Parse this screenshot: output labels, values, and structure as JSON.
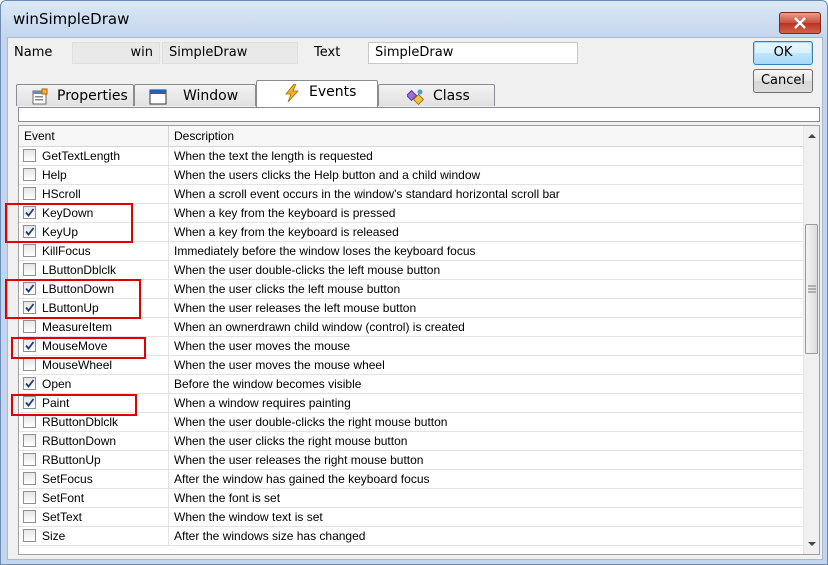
{
  "window": {
    "title": "winSimpleDraw"
  },
  "header": {
    "name_label": "Name",
    "name_prefix": "win",
    "name_value": "SimpleDraw",
    "text_label": "Text",
    "text_value": "SimpleDraw"
  },
  "buttons": {
    "ok": "OK",
    "cancel": "Cancel"
  },
  "tabs": [
    {
      "label": "Properties",
      "icon": "properties-icon"
    },
    {
      "label": "Window",
      "icon": "window-icon"
    },
    {
      "label": "Events",
      "icon": "lightning-icon",
      "active": true
    },
    {
      "label": "Class",
      "icon": "class-icon"
    }
  ],
  "grid": {
    "columns": [
      "Event",
      "Description"
    ],
    "rows": [
      {
        "event": "GetTextLength",
        "checked": false,
        "description": "When the text the length is requested"
      },
      {
        "event": "Help",
        "checked": false,
        "description": "When the users clicks the Help button and a child window"
      },
      {
        "event": "HScroll",
        "checked": false,
        "description": "When a scroll event occurs in the window's standard horizontal scroll bar"
      },
      {
        "event": "KeyDown",
        "checked": true,
        "description": "When a key from the keyboard is pressed"
      },
      {
        "event": "KeyUp",
        "checked": true,
        "description": "When a key from the keyboard is released"
      },
      {
        "event": "KillFocus",
        "checked": false,
        "description": "Immediately before the window loses the keyboard focus"
      },
      {
        "event": "LButtonDblclk",
        "checked": false,
        "description": "When the user double-clicks the left mouse button"
      },
      {
        "event": "LButtonDown",
        "checked": true,
        "description": "When the user clicks the left mouse button"
      },
      {
        "event": "LButtonUp",
        "checked": true,
        "description": "When the user releases the left mouse button"
      },
      {
        "event": "MeasureItem",
        "checked": false,
        "description": "When an ownerdrawn child window (control) is created"
      },
      {
        "event": "MouseMove",
        "checked": true,
        "description": "When the user moves the mouse"
      },
      {
        "event": "MouseWheel",
        "checked": false,
        "description": "When the user moves the mouse wheel"
      },
      {
        "event": "Open",
        "checked": true,
        "description": "Before the window becomes visible"
      },
      {
        "event": "Paint",
        "checked": true,
        "description": "When a window requires painting"
      },
      {
        "event": "RButtonDblclk",
        "checked": false,
        "description": "When the user double-clicks the right mouse button"
      },
      {
        "event": "RButtonDown",
        "checked": false,
        "description": "When the user clicks the right mouse button"
      },
      {
        "event": "RButtonUp",
        "checked": false,
        "description": "When the user releases the right mouse button"
      },
      {
        "event": "SetFocus",
        "checked": false,
        "description": "After the window has gained the keyboard focus"
      },
      {
        "event": "SetFont",
        "checked": false,
        "description": "When the font is set"
      },
      {
        "event": "SetText",
        "checked": false,
        "description": "When the window text is set"
      },
      {
        "event": "Size",
        "checked": false,
        "description": "After the windows size has changed"
      }
    ]
  },
  "highlight_color": "#e00000"
}
